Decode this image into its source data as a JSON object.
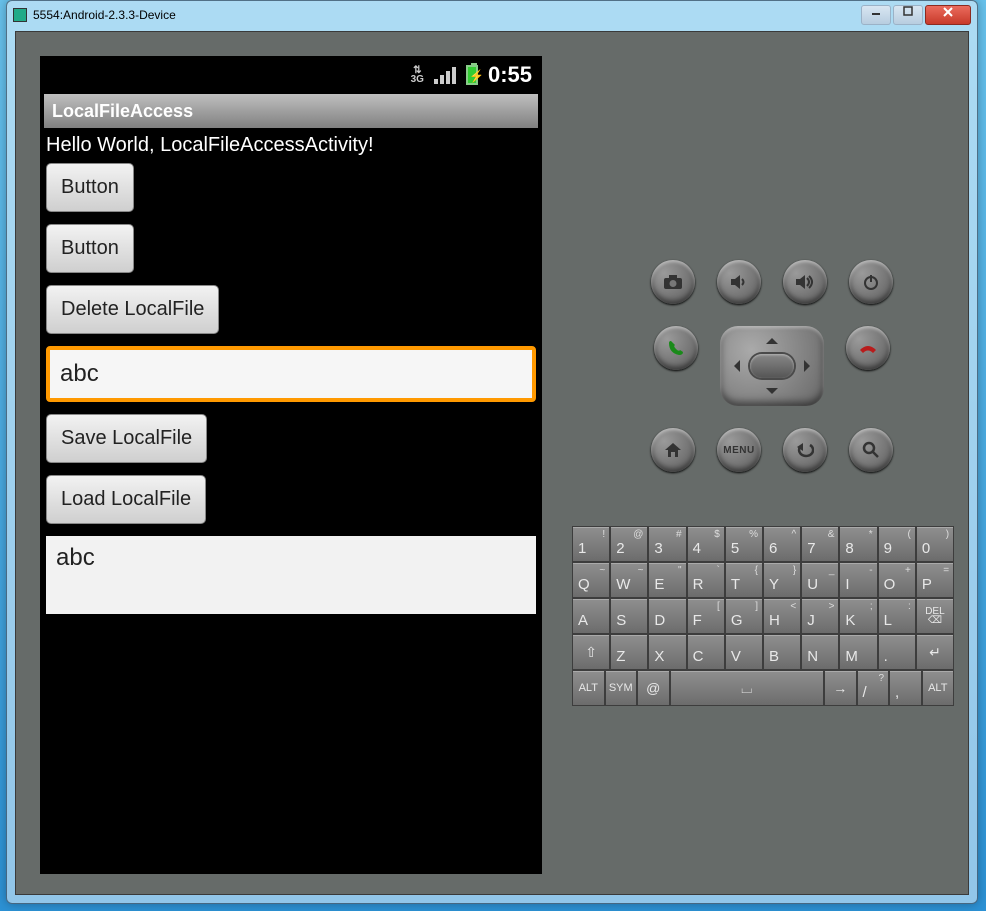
{
  "window": {
    "title": "5554:Android-2.3.3-Device"
  },
  "statusbar": {
    "time": "0:55",
    "network": "3G"
  },
  "app": {
    "title": "LocalFileAccess",
    "hello": "Hello World, LocalFileAccessActivity!",
    "button1": "Button",
    "button2": "Button",
    "delete": "Delete LocalFile",
    "input_value": "abc",
    "save": "Save LocalFile",
    "load": "Load LocalFile",
    "output": "abc"
  },
  "hw": {
    "menu": "MENU"
  },
  "keyboard": {
    "row1": [
      {
        "m": "1",
        "s": "!"
      },
      {
        "m": "2",
        "s": "@"
      },
      {
        "m": "3",
        "s": "#"
      },
      {
        "m": "4",
        "s": "$"
      },
      {
        "m": "5",
        "s": "%"
      },
      {
        "m": "6",
        "s": "^"
      },
      {
        "m": "7",
        "s": "&"
      },
      {
        "m": "8",
        "s": "*"
      },
      {
        "m": "9",
        "s": "("
      },
      {
        "m": "0",
        "s": ")"
      }
    ],
    "row2": [
      {
        "m": "Q",
        "s": "~"
      },
      {
        "m": "W",
        "s": "~"
      },
      {
        "m": "E",
        "s": "\""
      },
      {
        "m": "R",
        "s": "`"
      },
      {
        "m": "T",
        "s": "{"
      },
      {
        "m": "Y",
        "s": "}"
      },
      {
        "m": "U",
        "s": "_"
      },
      {
        "m": "I",
        "s": "-"
      },
      {
        "m": "O",
        "s": "+"
      },
      {
        "m": "P",
        "s": "="
      }
    ],
    "row3": [
      {
        "m": "A",
        "s": ""
      },
      {
        "m": "S",
        "s": ""
      },
      {
        "m": "D",
        "s": ""
      },
      {
        "m": "F",
        "s": "["
      },
      {
        "m": "G",
        "s": "]"
      },
      {
        "m": "H",
        "s": "<"
      },
      {
        "m": "J",
        "s": ">"
      },
      {
        "m": "K",
        "s": ";"
      },
      {
        "m": "L",
        "s": ":"
      }
    ],
    "row3_del": "DEL",
    "row4": [
      {
        "m": "Z"
      },
      {
        "m": "X"
      },
      {
        "m": "C"
      },
      {
        "m": "V"
      },
      {
        "m": "B"
      },
      {
        "m": "N"
      },
      {
        "m": "M"
      },
      {
        "m": "."
      },
      {
        "m": "↵"
      }
    ],
    "row4_shift": "⇧",
    "row5": {
      "alt_l": "ALT",
      "sym": "SYM",
      "at": "@",
      "space": "⎵",
      "arrow": "→",
      "slash": "/",
      "q": "?",
      "comma": ",",
      "alt_r": "ALT"
    }
  }
}
